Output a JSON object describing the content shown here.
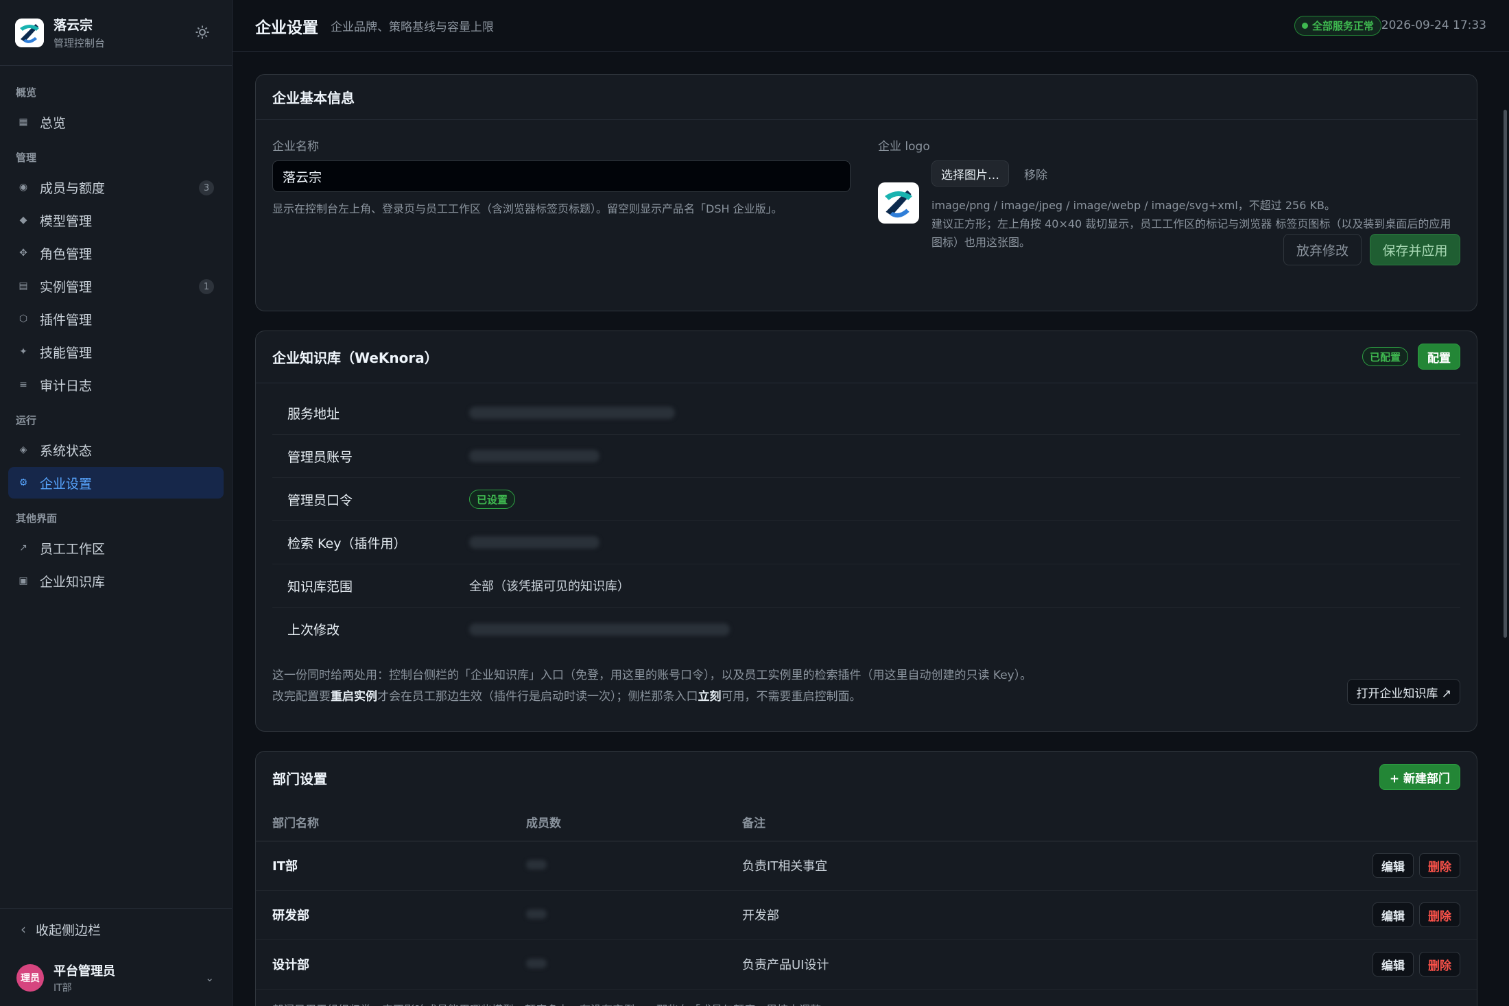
{
  "brand": {
    "name": "落云宗",
    "sub": "管理控制台"
  },
  "nav": {
    "groups": [
      {
        "label": "概览",
        "items": [
          {
            "label": "总览",
            "icon": "grid-icon"
          }
        ]
      },
      {
        "label": "管理",
        "items": [
          {
            "label": "成员与额度",
            "icon": "circle-icon",
            "badge": "3"
          },
          {
            "label": "模型管理",
            "icon": "diamond-icon"
          },
          {
            "label": "角色管理",
            "icon": "nodes-icon"
          },
          {
            "label": "实例管理",
            "icon": "server-icon",
            "badge": "1"
          },
          {
            "label": "插件管理",
            "icon": "hexagon-icon"
          },
          {
            "label": "技能管理",
            "icon": "sparkle-icon"
          },
          {
            "label": "审计日志",
            "icon": "list-icon"
          }
        ]
      },
      {
        "label": "运行",
        "items": [
          {
            "label": "系统状态",
            "icon": "pulse-icon"
          },
          {
            "label": "企业设置",
            "icon": "gear-icon",
            "active": true
          }
        ]
      },
      {
        "label": "其他界面",
        "items": [
          {
            "label": "员工工作区",
            "icon": "arrow-out-icon"
          },
          {
            "label": "企业知识库",
            "icon": "book-icon"
          }
        ]
      }
    ],
    "collapse_label": "收起侧边栏"
  },
  "user": {
    "avatar": "理员",
    "name": "平台管理员",
    "dept": "IT部"
  },
  "topbar": {
    "title": "企业设置",
    "subtitle": "企业品牌、策略基线与容量上限",
    "status": "全部服务正常",
    "datetime": "2026-09-24 17:33"
  },
  "basic": {
    "title": "企业基本信息",
    "name_label": "企业名称",
    "name_value": "落云宗",
    "name_hint": "显示在控制台左上角、登录页与员工工作区（含浏览器标签页标题）。留空则显示产品名「DSH 企业版」。",
    "logo_label": "企业 logo",
    "choose_btn": "选择图片…",
    "remove_btn": "移除",
    "logo_hint_1": "image/png / image/jpeg / image/webp / image/svg+xml，不超过 256 KB。",
    "logo_hint_2": "建议正方形；左上角按 40×40 裁切显示，员工工作区的标记与浏览器 标签页图标（以及装到桌面后的应用图标）也用这张图。",
    "discard_btn": "放弃修改",
    "save_btn": "保存并应用"
  },
  "kb": {
    "title": "企业知识库（WeKnora）",
    "status": "已配置",
    "config_btn": "配置",
    "rows": [
      {
        "key": "服务地址",
        "blurred": true
      },
      {
        "key": "管理员账号",
        "blurred": true
      },
      {
        "key": "管理员口令",
        "pill": "已设置"
      },
      {
        "key": "检索 Key（插件用）",
        "blurred": true
      },
      {
        "key": "知识库范围",
        "value": "全部（该凭据可见的知识库）"
      },
      {
        "key": "上次修改",
        "blurred": true
      }
    ],
    "note_1": "这一份同时给两处用：控制台侧栏的「企业知识库」入口（免登，用这里的账号口令），以及员工实例里的检索插件（用这里自动创建的只读 Key）。",
    "note_2_a": "改完配置要",
    "note_2_b": "重启实例",
    "note_2_c": "才会在员工那边生效（插件行是启动时读一次）；侧栏那条入口",
    "note_2_d": "立刻",
    "note_2_e": "可用，不需要重启控制面。",
    "open_btn": "打开企业知识库 ↗"
  },
  "dept": {
    "title": "部门设置",
    "new_btn": "+ 新建部门",
    "columns": [
      "部门名称",
      "成员数",
      "备注"
    ],
    "rows": [
      {
        "name": "IT部",
        "note": "负责IT相关事宜"
      },
      {
        "name": "研发部",
        "note": "开发部"
      },
      {
        "name": "设计部",
        "note": "负责产品UI设计"
      }
    ],
    "edit": "编辑",
    "delete": "删除",
    "footer_partial": "部门只用于组织归类：它不影响成员能用哪些模型、额度多少、有没有实例……那些在「成员与额度」里按人调整。"
  },
  "colors": {
    "accent": "#58a6ff",
    "green": "#3fb950",
    "danger": "#f85149",
    "bg": "#0d1117",
    "panel": "#161b22"
  }
}
